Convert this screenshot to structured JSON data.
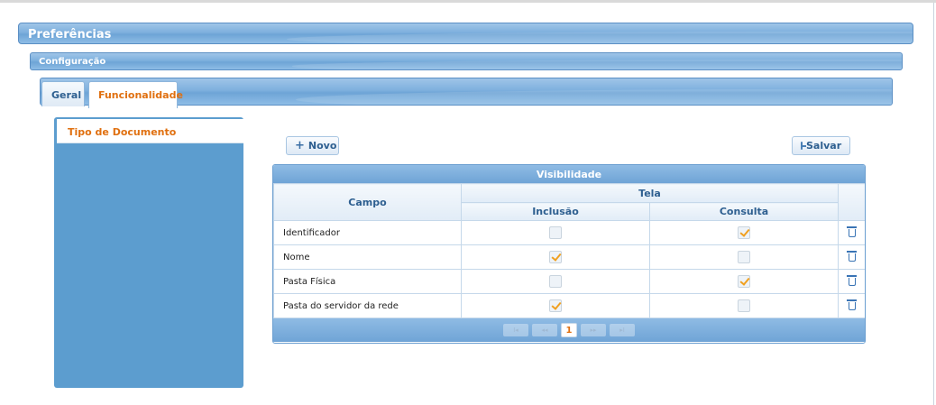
{
  "header": {
    "title": "Preferências"
  },
  "config": {
    "title": "Configuração"
  },
  "tabs": [
    {
      "label": "Geral",
      "active": false
    },
    {
      "label": "Funcionalidade",
      "active": true
    }
  ],
  "sidebar": {
    "items": [
      {
        "label": "Tipo de Documento",
        "selected": true
      }
    ]
  },
  "toolbar": {
    "new_label": "Novo",
    "save_label": "Salvar"
  },
  "grid": {
    "title": "Visibilidade",
    "col_campo": "Campo",
    "col_tela": "Tela",
    "col_inclusao": "Inclusão",
    "col_consulta": "Consulta",
    "rows": [
      {
        "campo": "Identificador",
        "inclusao": false,
        "consulta": true
      },
      {
        "campo": "Nome",
        "inclusao": true,
        "consulta": false
      },
      {
        "campo": "Pasta Física",
        "inclusao": false,
        "consulta": true
      },
      {
        "campo": "Pasta do servidor da rede",
        "inclusao": true,
        "consulta": false
      }
    ],
    "pager": {
      "current_page": "1"
    }
  },
  "colors": {
    "accent": "#e07010",
    "primary_blue": "#6ea4d6",
    "check": "#f0a020"
  }
}
